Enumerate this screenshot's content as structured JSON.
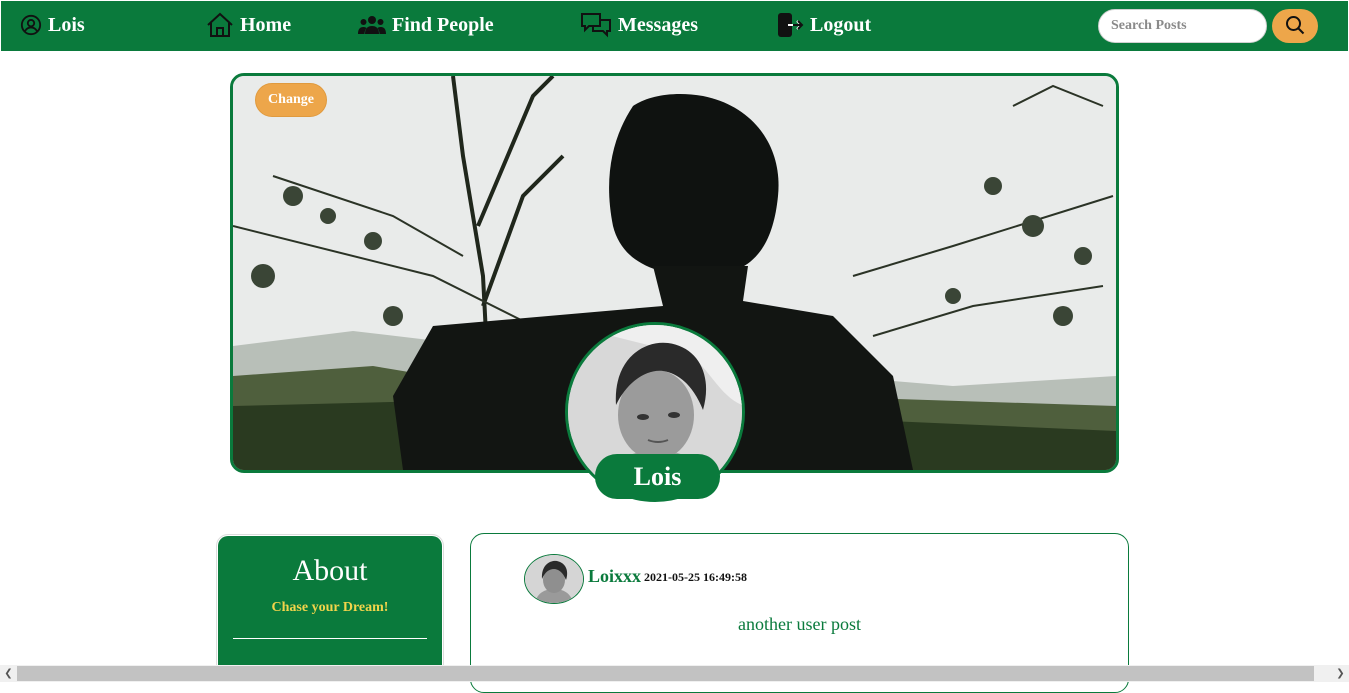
{
  "nav": {
    "user_label": "Lois",
    "home_label": "Home",
    "find_people_label": "Find People",
    "messages_label": "Messages",
    "logout_label": "Logout",
    "search_placeholder": "Search Posts",
    "icons": [
      "user-circle-icon",
      "house-icon",
      "people-icon",
      "chat-icon",
      "logout-icon",
      "search-icon"
    ]
  },
  "profile": {
    "change_cover_label": "Change",
    "name": "Lois"
  },
  "about": {
    "title": "About",
    "tagline": "Chase your Dream!"
  },
  "post": {
    "author": "Loixxx",
    "timestamp": "2021-05-25 16:49:58",
    "content": "another user post"
  },
  "colors": {
    "primary_green": "#0a7a3c",
    "accent_orange": "#eda64a",
    "tagline_yellow": "#f3d44b"
  }
}
